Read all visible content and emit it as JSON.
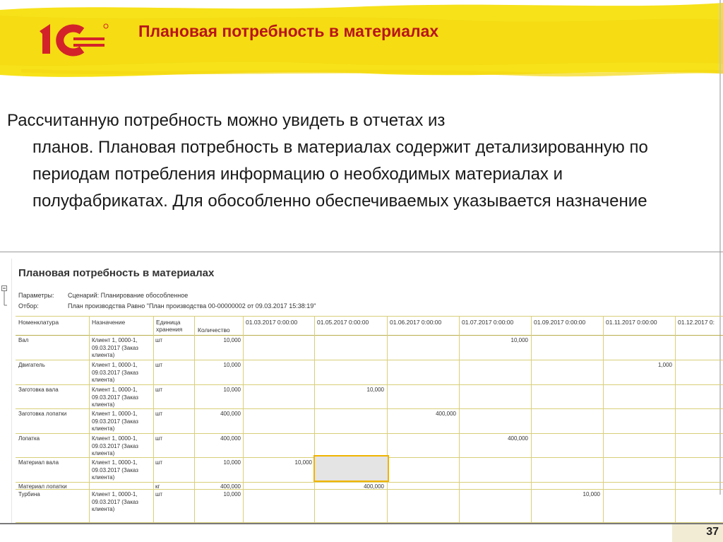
{
  "slide": {
    "title": "Плановая потребность в материалах",
    "paragraph_first": "Рассчитанную потребность можно увидеть в отчетах из",
    "paragraph_rest": "планов. Плановая потребность в материалах содержит детализированную по периодам потребления информацию о необходимых материалах и полуфабрикатах. Для обособленно обеспечиваемых указывается назначение",
    "page_number": "37",
    "brand": "1С",
    "colors": {
      "accent_yellow": "#f7e21a",
      "title_red": "#b8141a",
      "logo_red": "#d3222a",
      "selection": "#f0b400"
    }
  },
  "report": {
    "title": "Плановая потребность в материалах",
    "params": [
      {
        "label": "Параметры:",
        "value": "Сценарий: Планирование обособленное"
      },
      {
        "label": "Отбор:",
        "value": "План производства Равно \"План производства 00-00000002 от 09.03.2017 15:38:19\""
      }
    ],
    "columns": {
      "item": "Номенклатура",
      "destination": "Назначение",
      "unit": "Единица хранения",
      "quantity": "Количество"
    },
    "dates": [
      "01.03.2017 0:00:00",
      "01.05.2017 0:00:00",
      "01.06.2017 0:00:00",
      "01.07.2017 0:00:00",
      "01.09.2017 0:00:00",
      "01.11.2017 0:00:00",
      "01.12.2017 0:"
    ],
    "rows": [
      {
        "name": "Вал",
        "dest": "Клиент 1, 0000-1, 09.03.2017 (Заказ клиента)",
        "unit": "шт",
        "qty": "10,000",
        "value": "10,000"
      },
      {
        "name": "Двигатель",
        "dest": "Клиент 1, 0000-1, 09.03.2017 (Заказ клиента)",
        "unit": "шт",
        "qty": "10,000",
        "value": "1,000"
      },
      {
        "name": "Заготовка вала",
        "dest": "Клиент 1, 0000-1, 09.03.2017 (Заказ клиента)",
        "unit": "шт",
        "qty": "10,000",
        "value": "10,000"
      },
      {
        "name": "Заготовка лопатки",
        "dest": "Клиент 1, 0000-1, 09.03.2017 (Заказ клиента)",
        "unit": "шт",
        "qty": "400,000",
        "value": "400,000"
      },
      {
        "name": "Лопатка",
        "dest": "Клиент 1, 0000-1, 09.03.2017 (Заказ клиента)",
        "unit": "шт",
        "qty": "400,000",
        "value": "400,000"
      },
      {
        "name": "Материал вала",
        "dest": "Клиент 1, 0000-1, 09.03.2017 (Заказ клиента)",
        "unit": "шт",
        "qty": "10,000",
        "value": "10,000"
      },
      {
        "name": "Материал лопатки",
        "dest": "",
        "unit": "кг",
        "qty": "400,000",
        "value": "400,000"
      },
      {
        "name": "Турбина",
        "dest": "Клиент 1, 0000-1, 09.03.2017 (Заказ клиента)",
        "unit": "шт",
        "qty": "10,000",
        "value": "10,000"
      }
    ]
  }
}
